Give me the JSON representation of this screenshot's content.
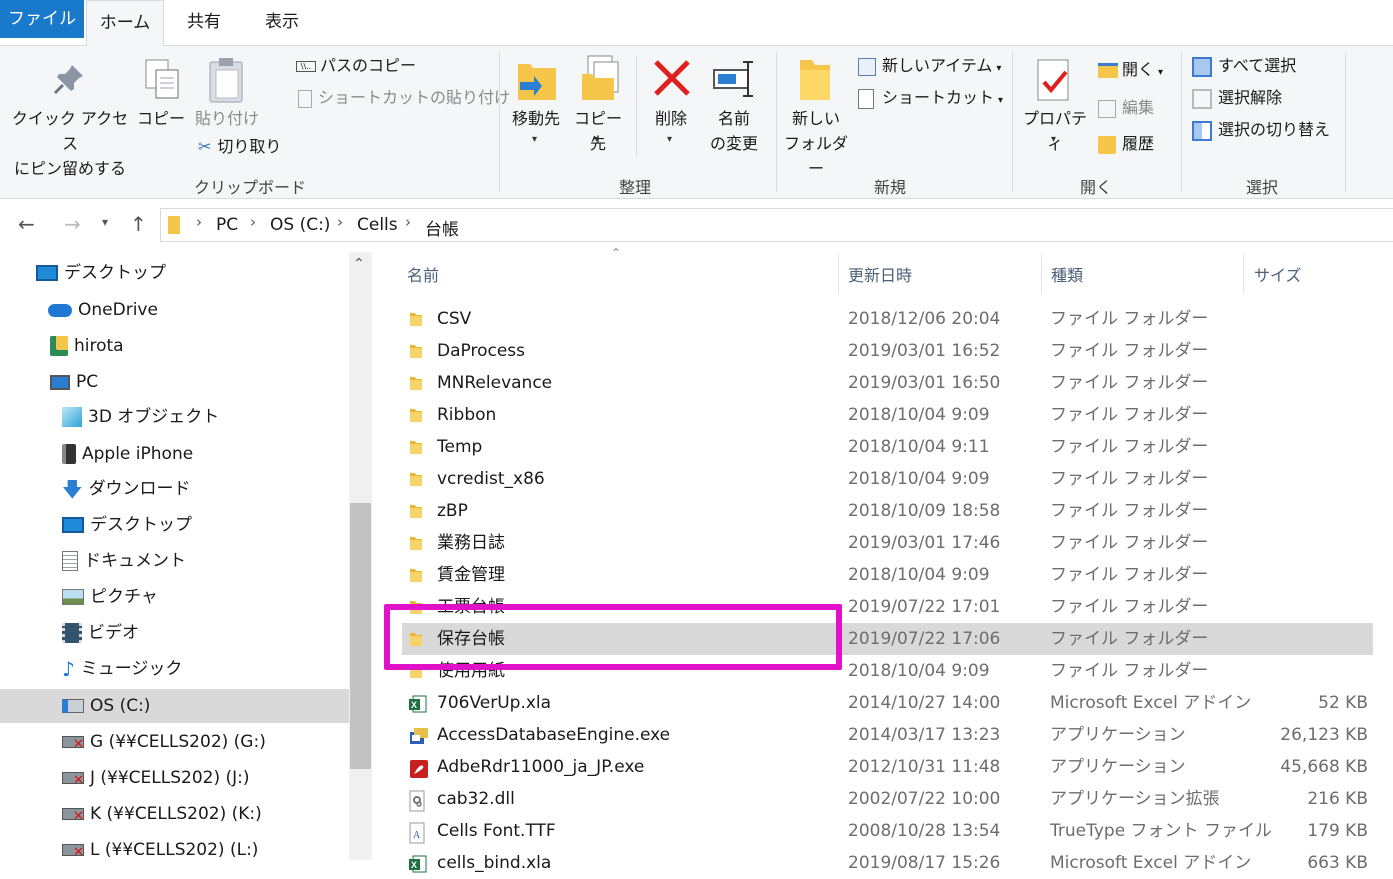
{
  "tabs": {
    "file": "ファイル",
    "home": "ホーム",
    "share": "共有",
    "view": "表示"
  },
  "ribbon": {
    "clipboard": {
      "label": "クリップボード",
      "pin_line1": "クイック アクセス",
      "pin_line2": "にピン留めする",
      "copy": "コピー",
      "paste": "貼り付け",
      "copy_path": "パスのコピー",
      "paste_shortcut": "ショートカットの貼り付け",
      "cut": "切り取り"
    },
    "organize": {
      "label": "整理",
      "move_to": "移動先",
      "copy_to": "コピー先",
      "delete": "削除",
      "rename_line1": "名前",
      "rename_line2": "の変更"
    },
    "new": {
      "label": "新規",
      "new_folder_line1": "新しい",
      "new_folder_line2": "フォルダー",
      "new_item": "新しいアイテム",
      "shortcut": "ショートカット"
    },
    "open": {
      "label": "開く",
      "properties": "プロパティ",
      "open": "開く",
      "edit": "編集",
      "history": "履歴"
    },
    "select": {
      "label": "選択",
      "select_all": "すべて選択",
      "select_none": "選択解除",
      "invert": "選択の切り替え"
    }
  },
  "address": {
    "crumbs": [
      "PC",
      "OS (C:)",
      "Cells",
      "台帳"
    ]
  },
  "nav": {
    "items": [
      {
        "label": "デスクトップ",
        "icon": "desktop-icon"
      },
      {
        "label": "OneDrive",
        "icon": "cloud-icon"
      },
      {
        "label": "hirota",
        "icon": "user-folder-icon"
      },
      {
        "label": "PC",
        "icon": "pc-icon"
      },
      {
        "label": "3D オブジェクト",
        "icon": "cube-icon"
      },
      {
        "label": "Apple iPhone",
        "icon": "phone-icon"
      },
      {
        "label": "ダウンロード",
        "icon": "download-icon"
      },
      {
        "label": "デスクトップ",
        "icon": "desktop-icon"
      },
      {
        "label": "ドキュメント",
        "icon": "document-icon"
      },
      {
        "label": "ピクチャ",
        "icon": "picture-icon"
      },
      {
        "label": "ビデオ",
        "icon": "video-icon"
      },
      {
        "label": "ミュージック",
        "icon": "music-icon"
      },
      {
        "label": "OS (C:)",
        "icon": "drive-icon"
      },
      {
        "label": "G (¥¥CELLS202) (G:)",
        "icon": "network-drive-icon"
      },
      {
        "label": "J (¥¥CELLS202) (J:)",
        "icon": "network-drive-icon"
      },
      {
        "label": "K (¥¥CELLS202) (K:)",
        "icon": "network-drive-icon"
      },
      {
        "label": "L (¥¥CELLS202) (L:)",
        "icon": "network-drive-icon"
      }
    ]
  },
  "columns": {
    "name": "名前",
    "date": "更新日時",
    "type": "種類",
    "size": "サイズ"
  },
  "files": [
    {
      "name": "CSV",
      "date": "2018/12/06 20:04",
      "type": "ファイル フォルダー",
      "size": "",
      "icon": "folder-icon"
    },
    {
      "name": "DaProcess",
      "date": "2019/03/01 16:52",
      "type": "ファイル フォルダー",
      "size": "",
      "icon": "folder-icon"
    },
    {
      "name": "MNRelevance",
      "date": "2019/03/01 16:50",
      "type": "ファイル フォルダー",
      "size": "",
      "icon": "folder-icon"
    },
    {
      "name": "Ribbon",
      "date": "2018/10/04 9:09",
      "type": "ファイル フォルダー",
      "size": "",
      "icon": "folder-icon"
    },
    {
      "name": "Temp",
      "date": "2018/10/04 9:11",
      "type": "ファイル フォルダー",
      "size": "",
      "icon": "folder-icon"
    },
    {
      "name": "vcredist_x86",
      "date": "2018/10/04 9:09",
      "type": "ファイル フォルダー",
      "size": "",
      "icon": "folder-icon"
    },
    {
      "name": "zBP",
      "date": "2018/10/09 18:58",
      "type": "ファイル フォルダー",
      "size": "",
      "icon": "folder-icon"
    },
    {
      "name": "業務日誌",
      "date": "2019/03/01 17:46",
      "type": "ファイル フォルダー",
      "size": "",
      "icon": "folder-icon"
    },
    {
      "name": "賃金管理",
      "date": "2018/10/04 9:09",
      "type": "ファイル フォルダー",
      "size": "",
      "icon": "folder-icon"
    },
    {
      "name": "工票台帳",
      "date": "2019/07/22 17:01",
      "type": "ファイル フォルダー",
      "size": "",
      "icon": "folder-icon"
    },
    {
      "name": "保存台帳",
      "date": "2019/07/22 17:06",
      "type": "ファイル フォルダー",
      "size": "",
      "icon": "folder-icon"
    },
    {
      "name": "使用用紙",
      "date": "2018/10/04 9:09",
      "type": "ファイル フォルダー",
      "size": "",
      "icon": "folder-icon"
    },
    {
      "name": "706VerUp.xla",
      "date": "2014/10/27 14:00",
      "type": "Microsoft Excel アドイン",
      "size": "52 KB",
      "icon": "excel-addin-icon"
    },
    {
      "name": "AccessDatabaseEngine.exe",
      "date": "2014/03/17 13:23",
      "type": "アプリケーション",
      "size": "26,123 KB",
      "icon": "installer-icon"
    },
    {
      "name": "AdbeRdr11000_ja_JP.exe",
      "date": "2012/10/31 11:48",
      "type": "アプリケーション",
      "size": "45,668 KB",
      "icon": "acrobat-icon"
    },
    {
      "name": "cab32.dll",
      "date": "2002/07/22 10:00",
      "type": "アプリケーション拡張",
      "size": "216 KB",
      "icon": "dll-icon"
    },
    {
      "name": "Cells Font.TTF",
      "date": "2008/10/28 13:54",
      "type": "TrueType フォント ファイル",
      "size": "179 KB",
      "icon": "font-file-icon"
    },
    {
      "name": "cells_bind.xla",
      "date": "2019/08/17 15:26",
      "type": "Microsoft Excel アドイン",
      "size": "663 KB",
      "icon": "excel-addin-icon"
    }
  ],
  "selected_row": 10,
  "colors": {
    "accent": "#1979ca",
    "highlight_box": "#e011c9",
    "selection": "#d9d9d9",
    "folder": "#f5c64a"
  }
}
